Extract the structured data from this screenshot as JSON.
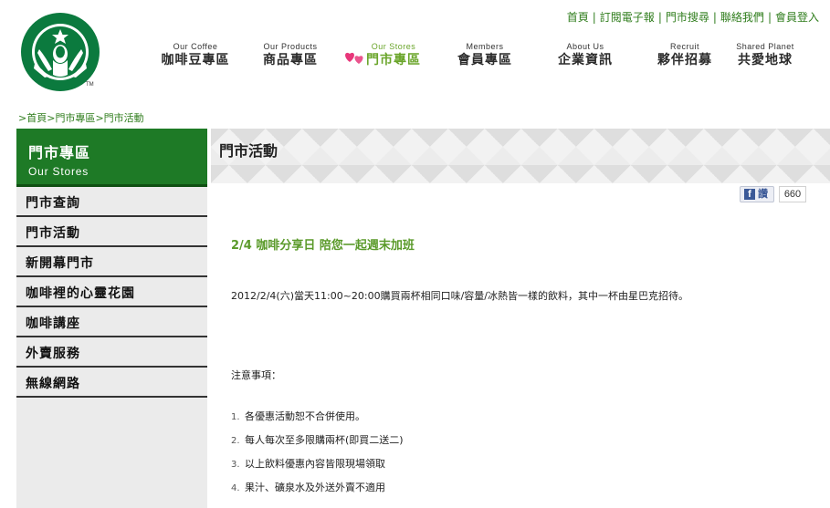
{
  "brand": {
    "logo_name": "starbucks-siren-logo",
    "tm": "TM",
    "green": "#1e7a26",
    "accent": "#6aa52a"
  },
  "toplinks": [
    "首頁",
    "訂閱電子報",
    "門市搜尋",
    "聯絡我們",
    "會員登入"
  ],
  "nav": [
    {
      "en": "Our Coffee",
      "zh": "咖啡豆專區"
    },
    {
      "en": "Our Products",
      "zh": "商品專區"
    },
    {
      "en": "Our Stores",
      "zh": "門市專區"
    },
    {
      "en": "Members",
      "zh": "會員專區"
    },
    {
      "en": "About Us",
      "zh": "企業資訊"
    },
    {
      "en": "Recruit",
      "zh": "夥伴招募"
    },
    {
      "en": "Shared Planet",
      "zh": "共愛地球"
    }
  ],
  "breadcrumb": {
    "home": "首頁",
    "section": "門市專區",
    "page": "門市活動",
    "sep": ">"
  },
  "sidebar": {
    "title_zh": "門市專區",
    "title_en": "Our Stores",
    "items": [
      "門市查詢",
      "門市活動",
      "新開幕門市",
      "咖啡裡的心靈花園",
      "咖啡講座",
      "外賣服務",
      "無線網路"
    ]
  },
  "page_title": "門市活動",
  "facebook": {
    "label": "讚",
    "count": "660"
  },
  "article": {
    "title": "2/4 咖啡分享日 陪您一起週末加班",
    "body": "2012/2/4(六)當天11:00~20:00購買兩杯相同口味/容量/冰熱皆一樣的飲料，其中一杯由星巴克招待。",
    "notes_heading": "注意事項：",
    "notes": [
      {
        "num": "1.",
        "text": "各優惠活動恕不合併使用。"
      },
      {
        "num": "2.",
        "text": "每人每次至多限購兩杯(即買二送二)"
      },
      {
        "num": "3.",
        "text": "以上飲料優惠內容皆限現場領取"
      },
      {
        "num": "4.",
        "text": "果汁、礦泉水及外送外賣不適用"
      }
    ]
  }
}
